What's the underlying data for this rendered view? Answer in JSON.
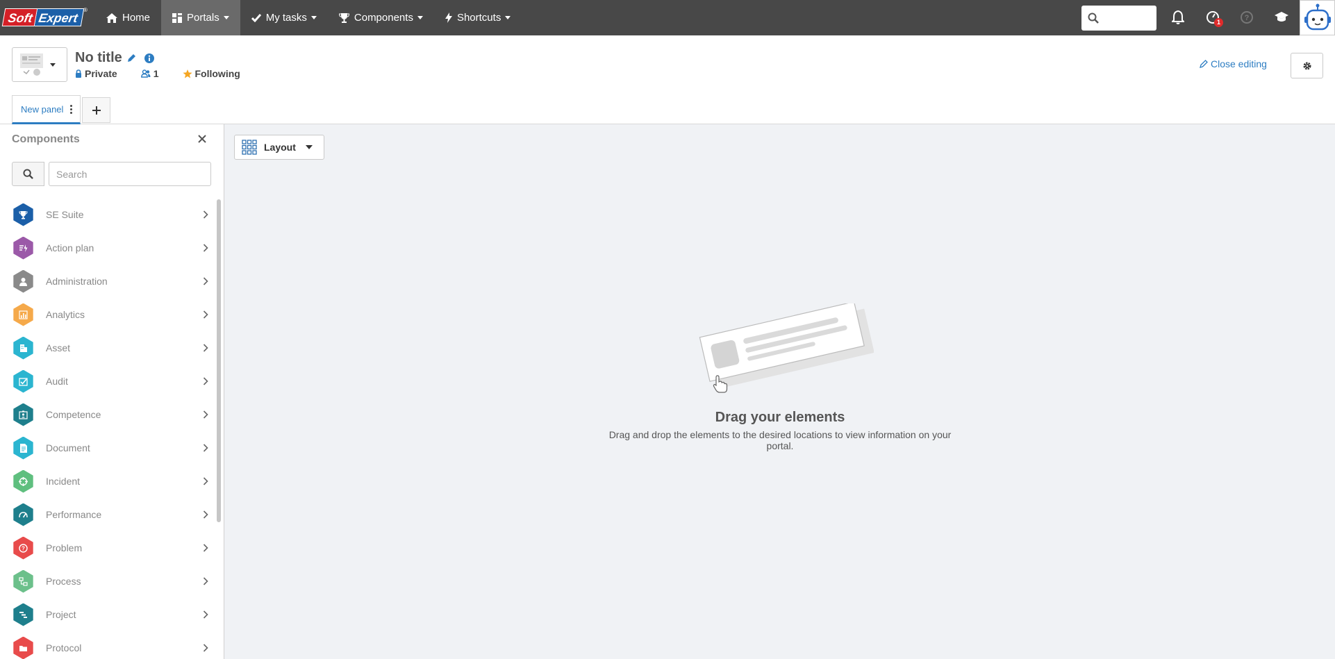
{
  "brand": {
    "part1": "Soft",
    "part2": "Expert",
    "reg": "®"
  },
  "topnav": [
    {
      "label": "Home",
      "icon": "home-icon",
      "caret": false,
      "active": false
    },
    {
      "label": "Portals",
      "icon": "portals-icon",
      "caret": true,
      "active": true
    },
    {
      "label": "My tasks",
      "icon": "check-icon",
      "caret": true,
      "active": false
    },
    {
      "label": "Components",
      "icon": "trophy-icon",
      "caret": true,
      "active": false
    },
    {
      "label": "Shortcuts",
      "icon": "bolt-icon",
      "caret": true,
      "active": false
    }
  ],
  "topbar_right": {
    "notification_badge": "1"
  },
  "portal": {
    "title": "No title",
    "privacy": "Private",
    "members": "1",
    "following": "Following",
    "close_editing": "Close editing"
  },
  "tabs": [
    {
      "label": "New panel"
    }
  ],
  "sidebar": {
    "title": "Components",
    "search_placeholder": "Search",
    "items": [
      {
        "label": "SE Suite",
        "color": "#1b5fa8",
        "icon": "trophy-icon"
      },
      {
        "label": "Action plan",
        "color": "#9b59a8",
        "icon": "action-plan-icon"
      },
      {
        "label": "Administration",
        "color": "#8a8a8a",
        "icon": "administration-icon"
      },
      {
        "label": "Analytics",
        "color": "#f5a94a",
        "icon": "analytics-icon"
      },
      {
        "label": "Asset",
        "color": "#2bb5d0",
        "icon": "asset-icon"
      },
      {
        "label": "Audit",
        "color": "#2bb5d0",
        "icon": "audit-icon"
      },
      {
        "label": "Competence",
        "color": "#1e7f8c",
        "icon": "competence-icon"
      },
      {
        "label": "Document",
        "color": "#2bb5d0",
        "icon": "document-icon"
      },
      {
        "label": "Incident",
        "color": "#5fbf7f",
        "icon": "incident-icon"
      },
      {
        "label": "Performance",
        "color": "#1e7f8c",
        "icon": "performance-icon"
      },
      {
        "label": "Problem",
        "color": "#e84b4b",
        "icon": "problem-icon"
      },
      {
        "label": "Process",
        "color": "#6cc08b",
        "icon": "process-icon"
      },
      {
        "label": "Project",
        "color": "#1e7f8c",
        "icon": "project-icon"
      },
      {
        "label": "Protocol",
        "color": "#e84b4b",
        "icon": "protocol-icon"
      }
    ]
  },
  "main": {
    "layout_label": "Layout",
    "empty_title": "Drag your elements",
    "empty_subtitle": "Drag and drop the elements to the desired locations to view information on your portal."
  }
}
